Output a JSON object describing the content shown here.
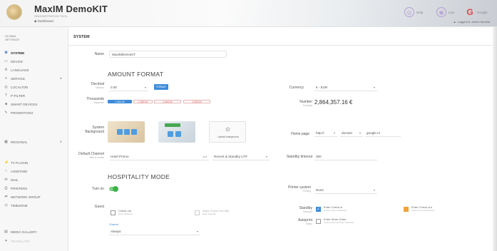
{
  "header": {
    "app_title": "MaxIM DemoKIT",
    "app_subtitle": "DEMONSTRATION TOOL",
    "dashboard_link": "Dashboard",
    "btn_a": "Help",
    "btn_b": "Live",
    "btn_c": "Google",
    "user": "Logged in: Admin Nexelia"
  },
  "sidebar": {
    "heading": [
      "GLOBAL",
      "SETTINGS"
    ],
    "items": [
      {
        "label": "SYSTEM",
        "icon": "wrench-icon"
      },
      {
        "label": "DEVICE",
        "icon": "device-icon"
      },
      {
        "label": "LANGUAGE",
        "icon": "language-icon"
      },
      {
        "label": "SERVICE",
        "icon": "service-icon"
      },
      {
        "label": "LOCALTON",
        "icon": "location-icon"
      },
      {
        "label": "P-FILTER",
        "icon": "filter-icon"
      },
      {
        "label": "SMART DEVICES",
        "icon": "smart-device-icon"
      },
      {
        "label": "PROMOTIONS",
        "icon": "promotion-icon"
      },
      {
        "label": "REGIONAL",
        "icon": "regional-icon"
      },
      {
        "label": "TV PLUGIN",
        "icon": "tv-plugin-icon"
      },
      {
        "label": "ASSETMID",
        "icon": "asset-icon"
      },
      {
        "label": "MAIL",
        "icon": "mail-icon"
      },
      {
        "label": "PRINTERS",
        "icon": "printer-icon"
      },
      {
        "label": "NETWORK GROUP",
        "icon": "network-icon"
      },
      {
        "label": "TIMEZONE",
        "icon": "timezone-icon"
      },
      {
        "label": "MEDIA GALLERY",
        "icon": "media-icon"
      },
      {
        "label": "TRANSLATE",
        "icon": "translate-icon"
      }
    ]
  },
  "main": {
    "section_title": "SYSTEM",
    "name_label": "Name",
    "name_value": "MaxIMDemoKIT",
    "amount_format_title": "AMOUNT FORMAT",
    "decimal_label": "Decimal",
    "decimal_sub": "Number",
    "decimal_value": "0.00",
    "format_chip": "FORMAT",
    "currency_label": "Currency",
    "currency_value": "€ - EUR",
    "thousands_label": "Thousands",
    "thousands_sub": "Separator",
    "thousands_chips": [
      "1 000.00",
      "1,000.00",
      "1.000,00",
      "1'000.00"
    ],
    "number_label": "Number",
    "number_sub": "Example",
    "number_value": "2,864,357.16 €",
    "system_bg_label": "System",
    "system_bg_label2": "Background",
    "upload_label": "Upload background",
    "homepage_label": "Home page",
    "homepage_values": [
      "http://",
      "domain",
      "google.nl"
    ],
    "default_channel_label": "Default Channel",
    "default_channel_sub": "Web & mobile",
    "default_channel_value": "Hotel Promo",
    "recent_value": "Recent & Standby UTF",
    "standby_label": "Standby timeout",
    "standby_value": "300",
    "hospitality_title": "HOSPITALITY MODE",
    "turn_on_label": "Turn on",
    "printer_system_label": "Printer system",
    "printer_system_sub": "Printing",
    "printer_system_value": "None",
    "guest_label": "Guest",
    "check_in_text": "Check out",
    "check_in_sub": "Enter Selection",
    "allow_check_text": "Allow Check Out Slip",
    "allow_check_sub": "Enter Settings",
    "standby_label2": "Standby",
    "standby_sub2": "Selected",
    "standby_opt1": "Enter Check in",
    "standby_opt1_sub": "Custom Group Selection",
    "standby_opt2": "Enter Check out",
    "standby_opt2_sub": "Custom Group Selection",
    "autoprint_label": "Autoprint",
    "autoprint_sub": "Status",
    "autoprint_opt": "Enter Store Order",
    "autoprint_opt_sub": "Custom Group Printer Selection",
    "channel_sub_label": "Channel",
    "channel_sub_value": "Always"
  }
}
